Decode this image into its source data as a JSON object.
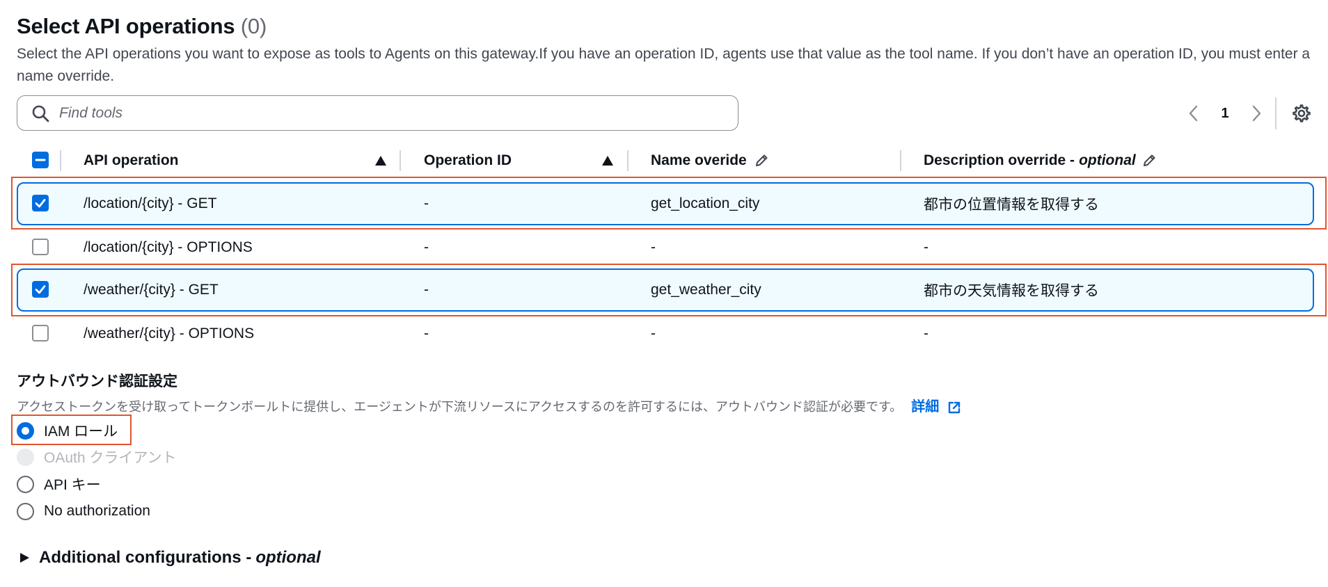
{
  "header": {
    "title": "Select API operations",
    "count": "(0)",
    "description": "Select the API operations you want to expose as tools to Agents on this gateway.If you have an operation ID, agents use that value as the tool name. If you don’t have an operation ID, you must enter a name override."
  },
  "search": {
    "placeholder": "Find tools",
    "icon": "search-icon"
  },
  "pagination": {
    "current_page": "1"
  },
  "table": {
    "columns": {
      "api_operation": "API operation",
      "operation_id": "Operation ID",
      "name_override": "Name overide",
      "description_override": "Description override - ",
      "description_override_optional": "optional"
    },
    "rows": [
      {
        "selected": true,
        "api_operation": "/location/{city} - GET",
        "operation_id": "-",
        "name_override": "get_location_city",
        "description_override": "都市の位置情報を取得する"
      },
      {
        "selected": false,
        "api_operation": "/location/{city} - OPTIONS",
        "operation_id": "-",
        "name_override": "-",
        "description_override": "-"
      },
      {
        "selected": true,
        "api_operation": "/weather/{city} - GET",
        "operation_id": "-",
        "name_override": "get_weather_city",
        "description_override": "都市の天気情報を取得する"
      },
      {
        "selected": false,
        "api_operation": "/weather/{city} - OPTIONS",
        "operation_id": "-",
        "name_override": "-",
        "description_override": "-"
      }
    ]
  },
  "outbound_auth": {
    "title": "アウトバウンド認証設定",
    "description": "アクセストークンを受け取ってトークンボールトに提供し、エージェントが下流リソースにアクセスするのを許可するには、アウトバウンド認証が必要です。",
    "link": "詳細",
    "options": [
      {
        "label": "IAM ロール",
        "selected": true,
        "disabled": false
      },
      {
        "label": "OAuth クライアント",
        "selected": false,
        "disabled": true
      },
      {
        "label": "API キー",
        "selected": false,
        "disabled": false
      },
      {
        "label": "No authorization",
        "selected": false,
        "disabled": false
      }
    ]
  },
  "additional": {
    "label": "Additional configurations - ",
    "optional": "optional"
  },
  "colors": {
    "accent": "#006ce0",
    "highlight": "#e2542d",
    "selected_row_bg": "#f0fbff"
  }
}
